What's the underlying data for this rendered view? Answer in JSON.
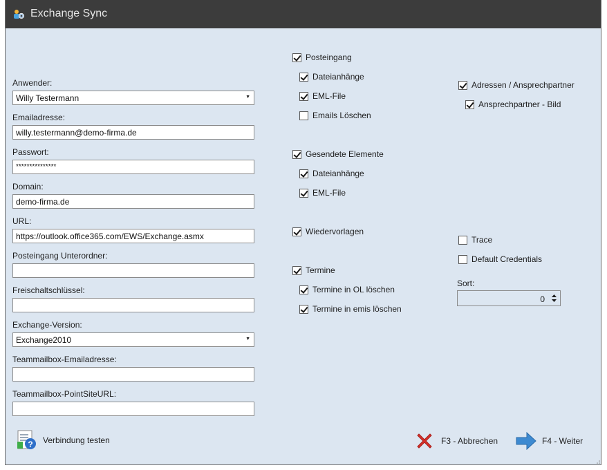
{
  "window": {
    "title": "Exchange Sync"
  },
  "form": {
    "user_label": "Anwender:",
    "user_value": "Willy Testermann",
    "email_label": "Emailadresse:",
    "email_value": "willy.testermann@demo-firma.de",
    "password_label": "Passwort:",
    "password_value": "***************",
    "domain_label": "Domain:",
    "domain_value": "demo-firma.de",
    "url_label": "URL:",
    "url_value": "https://outlook.office365.com/EWS/Exchange.asmx",
    "inbox_subfolder_label": "Posteingang Unterordner:",
    "inbox_subfolder_value": "",
    "license_key_label": "Freischaltschlüssel:",
    "license_key_value": "",
    "exchange_version_label": "Exchange-Version:",
    "exchange_version_value": "Exchange2010",
    "team_mailbox_email_label": "Teammailbox-Emailadresse:",
    "team_mailbox_email_value": "",
    "team_mailbox_url_label": "Teammailbox-PointSiteURL:",
    "team_mailbox_url_value": ""
  },
  "options": {
    "inbox": {
      "label": "Posteingang",
      "checked": true
    },
    "inbox_attachments": {
      "label": "Dateianhänge",
      "checked": true
    },
    "inbox_eml": {
      "label": "EML-File",
      "checked": true
    },
    "inbox_delete": {
      "label": "Emails Löschen",
      "checked": false
    },
    "sent": {
      "label": "Gesendete Elemente",
      "checked": true
    },
    "sent_attachments": {
      "label": "Dateianhänge",
      "checked": true
    },
    "sent_eml": {
      "label": "EML-File",
      "checked": true
    },
    "followups": {
      "label": "Wiedervorlagen",
      "checked": true
    },
    "appointments": {
      "label": "Termine",
      "checked": true
    },
    "appt_delete_ol": {
      "label": "Termine in OL löschen",
      "checked": true
    },
    "appt_delete_emis": {
      "label": "Termine in emis löschen",
      "checked": true
    },
    "addresses": {
      "label": "Adressen / Ansprechpartner",
      "checked": true
    },
    "contact_image": {
      "label": "Ansprechpartner - Bild",
      "checked": true
    },
    "trace": {
      "label": "Trace",
      "checked": false
    },
    "default_credentials": {
      "label": "Default Credentials",
      "checked": false
    }
  },
  "sort": {
    "label": "Sort:",
    "value": "0"
  },
  "buttons": {
    "test_connection": "Verbindung testen",
    "cancel": "F3 - Abbrechen",
    "next": "F4 - Weiter"
  },
  "colors": {
    "titlebar": "#3c3c3c",
    "background": "#dce6f1",
    "cancel_red": "#d9312b",
    "next_blue": "#3d8ad1"
  }
}
